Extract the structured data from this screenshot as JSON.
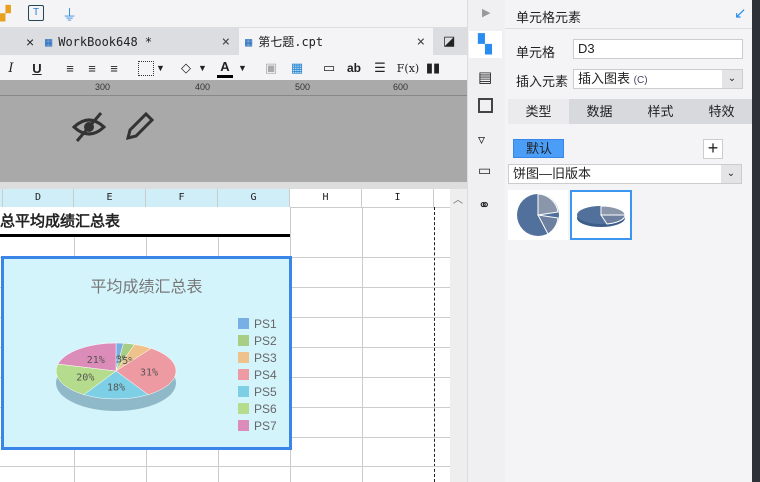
{
  "tabs": [
    {
      "label": "WorkBook648 *"
    },
    {
      "label": "第七题.cpt"
    }
  ],
  "toolbar": {
    "italic": "I",
    "underline": "U",
    "text_ab": "ab",
    "formula": "F(x)"
  },
  "ruler": {
    "ticks": [
      "300",
      "400",
      "500",
      "600"
    ]
  },
  "sheet": {
    "columns": [
      "D",
      "E",
      "F",
      "G",
      "H",
      "I"
    ],
    "title_cell": "总平均成绩汇总表"
  },
  "chart_data": {
    "type": "pie",
    "title": "平均成绩汇总表",
    "categories": [
      "PS1",
      "PS2",
      "PS3",
      "PS4",
      "PS5",
      "PS6",
      "PS7"
    ],
    "values": [
      2,
      3,
      5,
      31,
      18,
      20,
      21
    ],
    "labels": [
      "2%",
      "3%",
      "5%",
      "31%",
      "18%",
      "20%",
      "21%"
    ],
    "colors": [
      "#78b0e6",
      "#a8cd85",
      "#eec28a",
      "#ee9aa2",
      "#7dcfe6",
      "#b5dc8c",
      "#dc8cb8"
    ],
    "legend": "right"
  },
  "panel": {
    "title": "单元格元素",
    "cell_label": "单元格",
    "cell_value": "D3",
    "insert_label": "插入元素",
    "insert_value": "插入图表",
    "insert_hotkey": "(C)",
    "tabs": [
      "类型",
      "数据",
      "样式",
      "特效"
    ],
    "default_btn": "默认",
    "plus": "+",
    "chart_type": "饼图—旧版本"
  }
}
